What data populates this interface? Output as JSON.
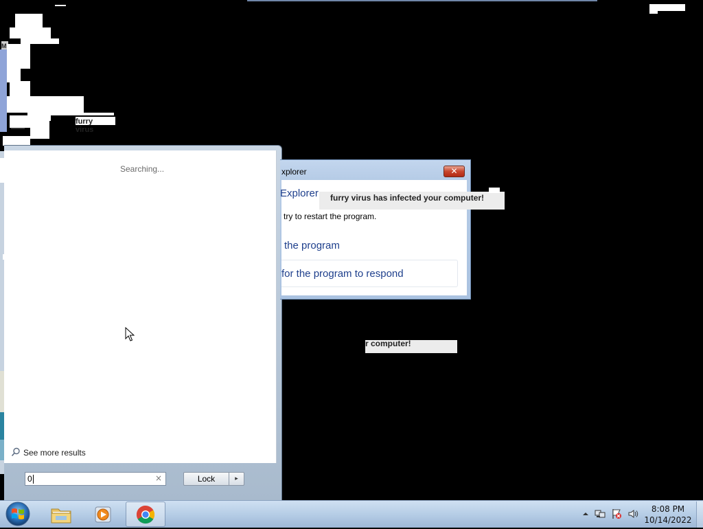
{
  "desktop": {
    "background_color": "#000000",
    "glitch_label": "furry virus",
    "glitch_prefix": "M"
  },
  "start_menu": {
    "status_text": "Searching...",
    "see_more_label": "See more results",
    "search_value": "0",
    "clear_glyph": "×",
    "lock_label": "Lock",
    "lock_arrow_glyph": "▸"
  },
  "dialog": {
    "title": "xplorer",
    "close_glyph": "✕",
    "heading": "Explorer",
    "subtext": "try to restart the program.",
    "option_close": "the program",
    "option_wait": "for the program to respond"
  },
  "virus_popup": {
    "message": "furry virus has infected your computer!",
    "fragment": "r computer!"
  },
  "taskbar": {
    "start_icon": "windows-orb-icon",
    "apps": [
      {
        "name": "file-explorer",
        "icon": "folder-icon"
      },
      {
        "name": "media-player",
        "icon": "media-player-icon"
      },
      {
        "name": "chrome",
        "icon": "chrome-icon",
        "active": true
      }
    ],
    "tray": {
      "time": "8:08 PM",
      "date": "10/14/2022",
      "icons": [
        "show-hidden-icons-icon",
        "network-icon",
        "action-center-icon",
        "volume-icon"
      ]
    }
  },
  "colors": {
    "dialog_link": "#1e3f8c",
    "close_red": "#c8452c",
    "taskbar": "#b6cde6"
  }
}
